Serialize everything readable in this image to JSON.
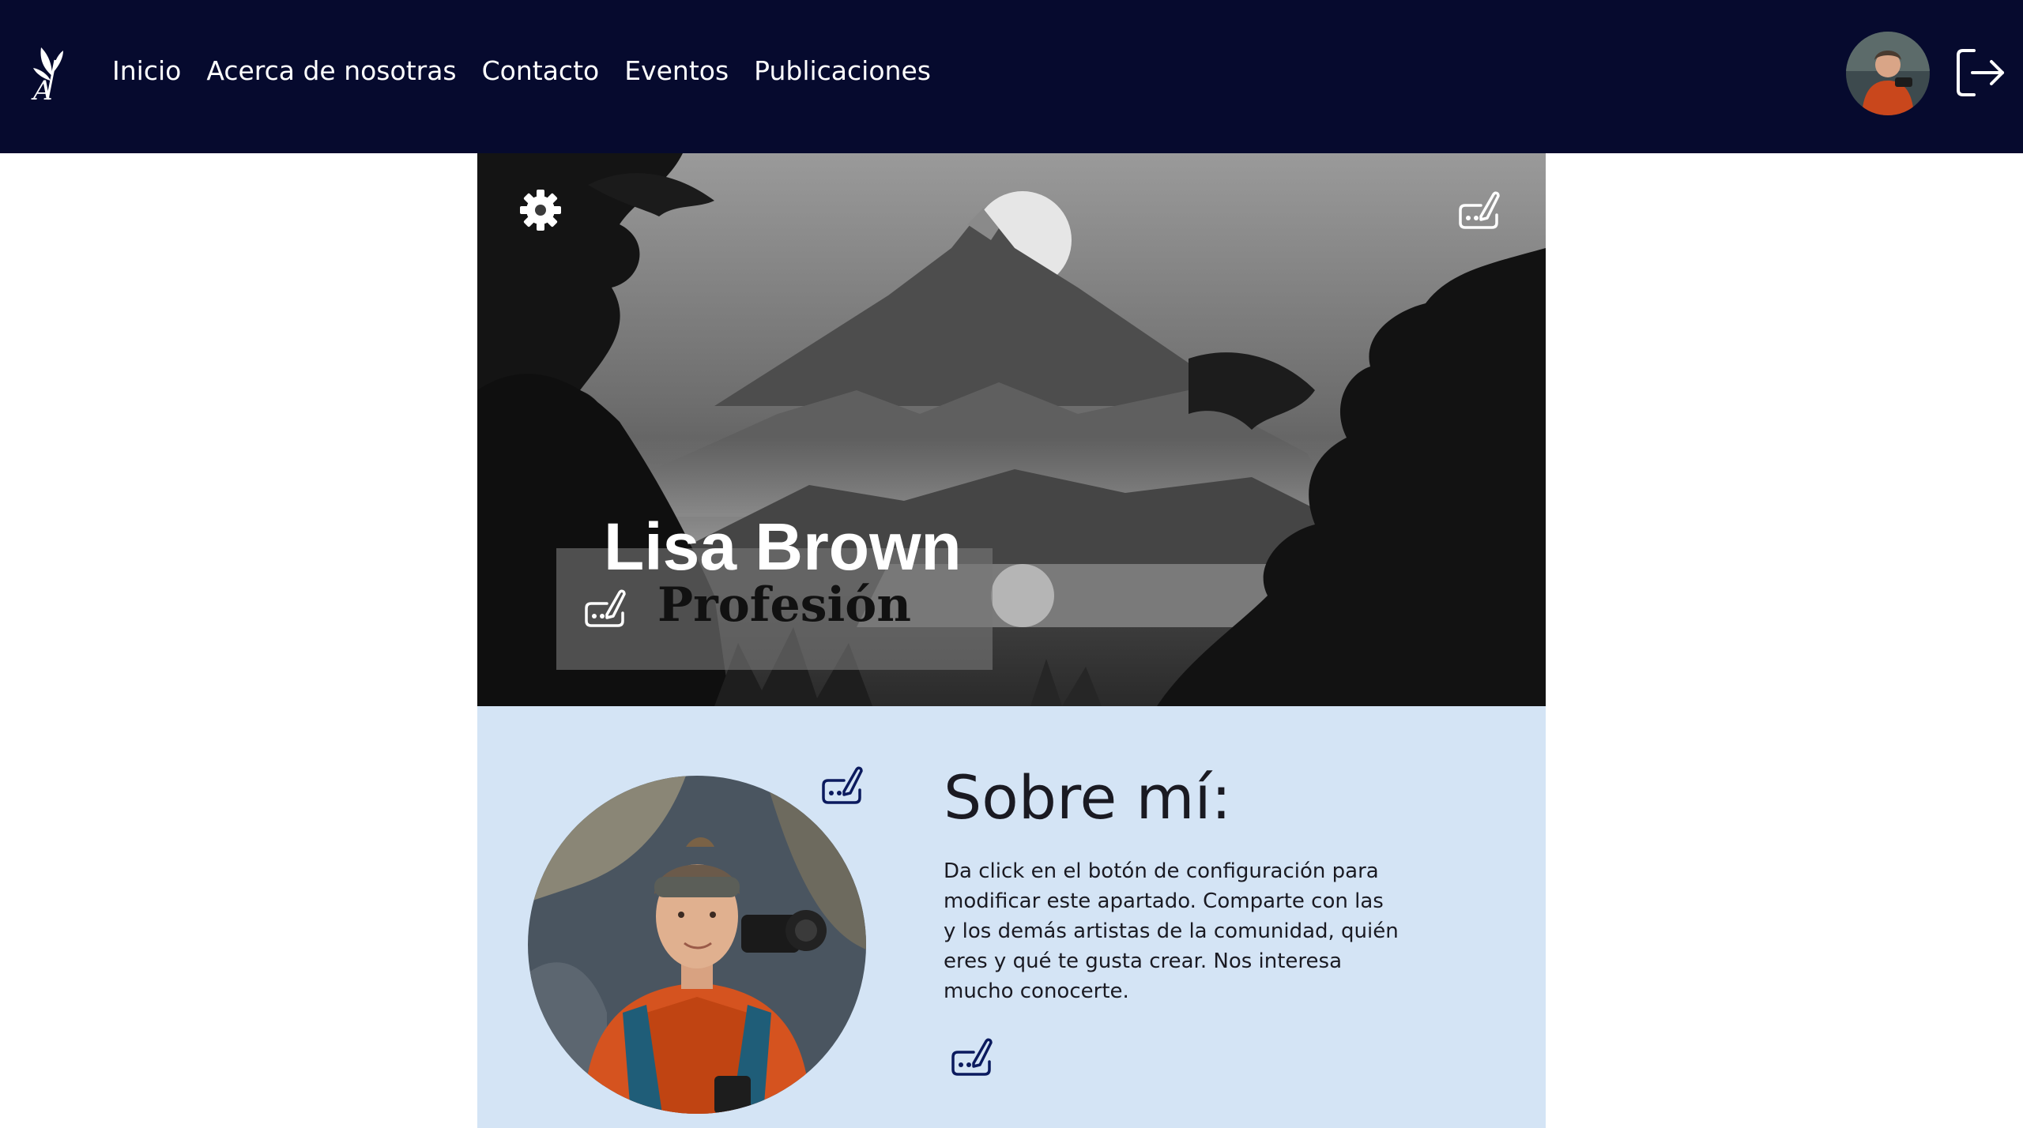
{
  "navbar": {
    "logo": "leaf-a-logo",
    "links": [
      {
        "label": "Inicio"
      },
      {
        "label": "Acerca de nosotras"
      },
      {
        "label": "Contacto"
      },
      {
        "label": "Eventos"
      },
      {
        "label": "Publicaciones"
      }
    ],
    "avatar": "user-avatar",
    "logout_icon": "logout-icon"
  },
  "hero": {
    "settings_icon": "gear-icon",
    "edit_cover_icon": "edit-icon",
    "name": "Lisa Brown",
    "profession": "Profesión",
    "edit_profession_icon": "edit-icon"
  },
  "about": {
    "title": "Sobre mí:",
    "text": "Da click en el botón de configuración para modificar este apartado. Comparte con las y los demás artistas de la comunidad, quién eres y qué te gusta crear. Nos interesa mucho conocerte.",
    "edit_photo_icon": "edit-icon",
    "edit_text_icon": "edit-icon"
  },
  "colors": {
    "navbar_bg": "#060a2e",
    "about_bg": "#d4e4f5",
    "icon_dark_blue": "#0b1a5e"
  }
}
